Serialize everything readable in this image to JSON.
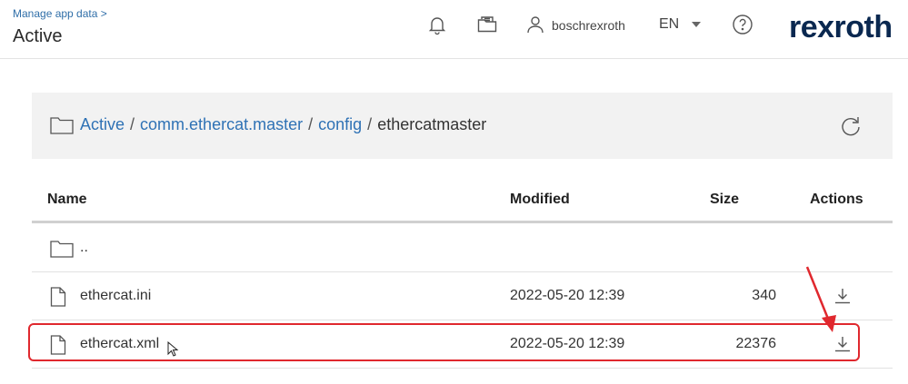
{
  "header": {
    "breadcrumb_top": "Manage app data >",
    "title": "Active",
    "username": "boschrexroth",
    "language": "EN",
    "logo_text": "rexroth",
    "icons": [
      "bell-icon",
      "folder-open-icon",
      "user-icon",
      "help-icon"
    ]
  },
  "path": {
    "segments": [
      "Active",
      "comm.ethercat.master",
      "config",
      "ethercatmaster"
    ],
    "separator": "/"
  },
  "table": {
    "columns": [
      "Name",
      "Modified",
      "Size",
      "Actions"
    ],
    "rows": [
      {
        "name": "..",
        "modified": "",
        "size": "",
        "type": "folder"
      },
      {
        "name": "ethercat.ini",
        "modified": "2022-05-20 12:39",
        "size": "340",
        "type": "file"
      },
      {
        "name": "ethercat.xml",
        "modified": "2022-05-20 12:39",
        "size": "22376",
        "type": "file"
      }
    ]
  },
  "colors": {
    "link": "#2f72b5",
    "brand": "#0a2850",
    "annotation": "#e0282e",
    "pathbar_bg": "#f2f2f2"
  }
}
